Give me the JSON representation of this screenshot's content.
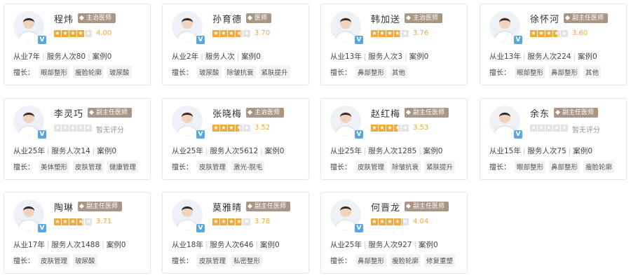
{
  "labels": {
    "years_prefix": "从业",
    "years_suffix": "年",
    "served_prefix": "服务人次",
    "cases_prefix": "案例",
    "specialty_label": "擅长：",
    "verified_badge": "V"
  },
  "colors": {
    "star_on": "#f0a93b",
    "star_off": "#e3e3e3",
    "title_badge": "#a99685",
    "verified": "#5aa7e0"
  },
  "doctors": [
    {
      "name": "程炜",
      "title": "主治医师",
      "stars": 4,
      "rating_text": "4.00",
      "years": "7",
      "served": "80",
      "cases": "0",
      "tags": [
        "眼部整形",
        "瘦脸轮廓",
        "玻尿酸"
      ]
    },
    {
      "name": "孙育德",
      "title": "医师",
      "stars": 3.7,
      "rating_text": "3.70",
      "years": "2",
      "served": "",
      "cases": "0",
      "tags": [
        "玻尿酸",
        "除皱抗衰",
        "紧肤提升"
      ]
    },
    {
      "name": "韩加送",
      "title": "主治医师",
      "stars": 3.76,
      "rating_text": "3.76",
      "years": "13",
      "served": "3",
      "cases": "0",
      "tags": [
        "鼻部整形",
        "其他"
      ]
    },
    {
      "name": "徐怀河",
      "title": "副主任医师",
      "stars": 3.6,
      "rating_text": "3.60",
      "years": "13",
      "served": "224",
      "cases": "0",
      "tags": [
        "眼部整形",
        "鼻部整形",
        "其他"
      ]
    },
    {
      "name": "李灵巧",
      "title": "副主任医师",
      "stars": 0,
      "rating_text": "暂无评分",
      "years": "25",
      "served": "14",
      "cases": "0",
      "tags": [
        "美体塑形",
        "皮肤管理",
        "健康管理"
      ]
    },
    {
      "name": "张晓梅",
      "title": "主治医师",
      "stars": 3.52,
      "rating_text": "3.52",
      "years": "25",
      "served": "5612",
      "cases": "0",
      "tags": [
        "皮肤管理",
        "激光-脱毛"
      ]
    },
    {
      "name": "赵红梅",
      "title": "副主任医师",
      "stars": 3.53,
      "rating_text": "3.53",
      "years": "25",
      "served": "1285",
      "cases": "0",
      "tags": [
        "皮肤管理",
        "除皱抗衰",
        "紧肤提升"
      ]
    },
    {
      "name": "余东",
      "title": "副主任医师",
      "stars": 0,
      "rating_text": "暂无评分",
      "years": "15",
      "served": "75",
      "cases": "0",
      "tags": [
        "眼部整形",
        "鼻部整形",
        "瘦脸轮廓"
      ]
    },
    {
      "name": "陶琳",
      "title": "副主任医师",
      "stars": 3.71,
      "rating_text": "3.71",
      "years": "17",
      "served": "1488",
      "cases": "0",
      "tags": [
        "皮肤管理",
        "玻尿酸"
      ]
    },
    {
      "name": "莫雅晴",
      "title": "副主任医师",
      "stars": 3.78,
      "rating_text": "3.78",
      "years": "18",
      "served": "646",
      "cases": "0",
      "tags": [
        "皮肤管理",
        "私密整形"
      ]
    },
    {
      "name": "何晋龙",
      "title": "副主任医师",
      "stars": 4.04,
      "rating_text": "4.04",
      "years": "25",
      "served": "927",
      "cases": "0",
      "tags": [
        "鼻部整形",
        "瘦脸轮廓",
        "修复重塑"
      ]
    }
  ]
}
